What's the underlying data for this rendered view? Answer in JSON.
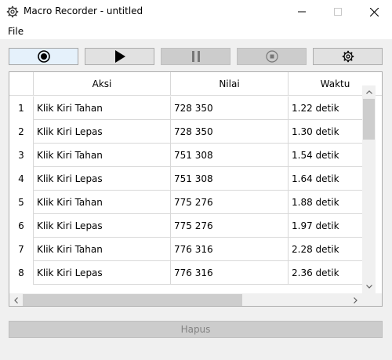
{
  "window": {
    "title": "Macro Recorder - untitled"
  },
  "menu": {
    "items": [
      "File"
    ]
  },
  "toolbar": {
    "record_icon": "record-icon",
    "play_icon": "play-icon",
    "pause_icon": "pause-icon",
    "stop_icon": "stop-icon",
    "settings_icon": "gear-icon"
  },
  "table": {
    "columns": [
      "Aksi",
      "Nilai",
      "Waktu"
    ],
    "rows": [
      {
        "index": "1",
        "aksi": "Klik Kiri Tahan",
        "nilai": "728 350",
        "waktu": "1.22 detik"
      },
      {
        "index": "2",
        "aksi": "Klik Kiri Lepas",
        "nilai": "728 350",
        "waktu": "1.30 detik"
      },
      {
        "index": "3",
        "aksi": "Klik Kiri Tahan",
        "nilai": "751 308",
        "waktu": "1.54 detik"
      },
      {
        "index": "4",
        "aksi": "Klik Kiri Lepas",
        "nilai": "751 308",
        "waktu": "1.64 detik"
      },
      {
        "index": "5",
        "aksi": "Klik Kiri Tahan",
        "nilai": "775 276",
        "waktu": "1.88 detik"
      },
      {
        "index": "6",
        "aksi": "Klik Kiri Lepas",
        "nilai": "775 276",
        "waktu": "1.97 detik"
      },
      {
        "index": "7",
        "aksi": "Klik Kiri Tahan",
        "nilai": "776 316",
        "waktu": "2.28 detik"
      },
      {
        "index": "8",
        "aksi": "Klik Kiri Lepas",
        "nilai": "776 316",
        "waktu": "2.36 detik"
      }
    ]
  },
  "footer": {
    "clear_label": "Hapus"
  },
  "colors": {
    "window_bg": "#f0f0f0",
    "button_face": "#e1e1e1",
    "active_button": "#e5f1fb",
    "disabled_button": "#cccccc",
    "disabled_text": "#838383",
    "grid_line": "#d8d8d8"
  }
}
